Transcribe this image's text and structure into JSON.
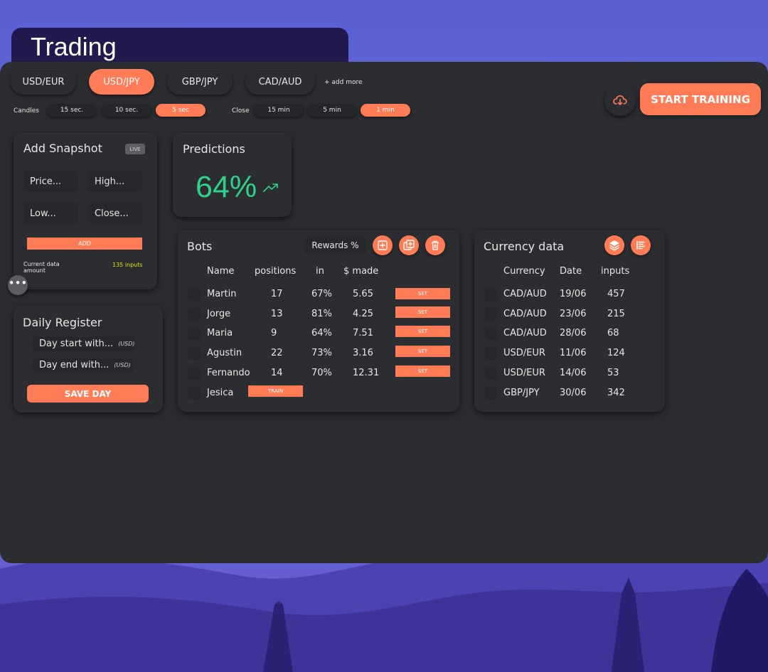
{
  "app": {
    "title": "Trading"
  },
  "pairs": [
    {
      "label": "USD/EUR",
      "active": false
    },
    {
      "label": "USD/JPY",
      "active": true
    },
    {
      "label": "GBP/JPY",
      "active": false
    },
    {
      "label": "CAD/AUD",
      "active": false
    }
  ],
  "add_more_label": "+ add more",
  "candles": {
    "label": "Candles",
    "options": [
      {
        "label": "15 sec.",
        "active": false
      },
      {
        "label": "10 sec.",
        "active": false
      },
      {
        "label": "5 sec",
        "active": true
      }
    ]
  },
  "close": {
    "label": "Close",
    "options": [
      {
        "label": "15 min",
        "active": false
      },
      {
        "label": "5 min",
        "active": false
      },
      {
        "label": "1 min",
        "active": true
      }
    ]
  },
  "start_training_label": "START TRAINING",
  "snapshot": {
    "title": "Add Snapshot",
    "badge": "LIVE",
    "price_placeholder": "Price...",
    "high_placeholder": "High...",
    "low_placeholder": "Low...",
    "close_placeholder": "Close...",
    "add_label": "ADD",
    "current_label": "Current data amount",
    "current_value": "135 inputs"
  },
  "register": {
    "title": "Daily Register",
    "start_label": "Day start with...",
    "end_label": "Day end with...",
    "unit": "(USD)",
    "save_label": "SAVE DAY"
  },
  "predictions": {
    "title": "Predictions",
    "value": "64%"
  },
  "bots": {
    "title": "Bots",
    "rewards_label": "Rewards %",
    "columns": [
      "Name",
      "positions",
      "in",
      "$ made"
    ],
    "rows": [
      {
        "name": "Martin",
        "positions": "17",
        "in": "67%",
        "made": "5.65",
        "action": "SET"
      },
      {
        "name": "Jorge",
        "positions": "13",
        "in": "81%",
        "made": "4.25",
        "action": "SET"
      },
      {
        "name": "Maria",
        "positions": "9",
        "in": "64%",
        "made": "7.51",
        "action": "SET"
      },
      {
        "name": "Agustin",
        "positions": "22",
        "in": "73%",
        "made": "3.16",
        "action": "SET"
      },
      {
        "name": "Fernando",
        "positions": "14",
        "in": "70%",
        "made": "12.31",
        "action": "SET"
      },
      {
        "name": "Jesica",
        "positions": "",
        "in": "",
        "made": "",
        "action": "TRAIN"
      }
    ]
  },
  "currency": {
    "title": "Currency data",
    "columns": [
      "Currency",
      "Date",
      "inputs"
    ],
    "rows": [
      {
        "currency": "CAD/AUD",
        "date": "19/06",
        "inputs": "457"
      },
      {
        "currency": "CAD/AUD",
        "date": "23/06",
        "inputs": "215"
      },
      {
        "currency": "CAD/AUD",
        "date": "28/06",
        "inputs": "68"
      },
      {
        "currency": "USD/EUR",
        "date": "11/06",
        "inputs": "124"
      },
      {
        "currency": "USD/EUR",
        "date": "14/06",
        "inputs": "53"
      },
      {
        "currency": "GBP/JPY",
        "date": "30/06",
        "inputs": "342"
      }
    ]
  },
  "colors": {
    "accent": "#ff7c57",
    "panel": "#2b2d31",
    "field": "#26282b",
    "positive": "#2fd28a",
    "highlight": "#e6e600",
    "title_bg": "#221a4e"
  },
  "icons": {
    "cloud": "cloud-download-icon",
    "trend": "trending-up-icon",
    "add": "add-square-icon",
    "duplicate": "duplicate-icon",
    "delete": "trash-icon",
    "layers": "layers-icon",
    "list": "list-icon",
    "more": "more-dots-icon"
  }
}
